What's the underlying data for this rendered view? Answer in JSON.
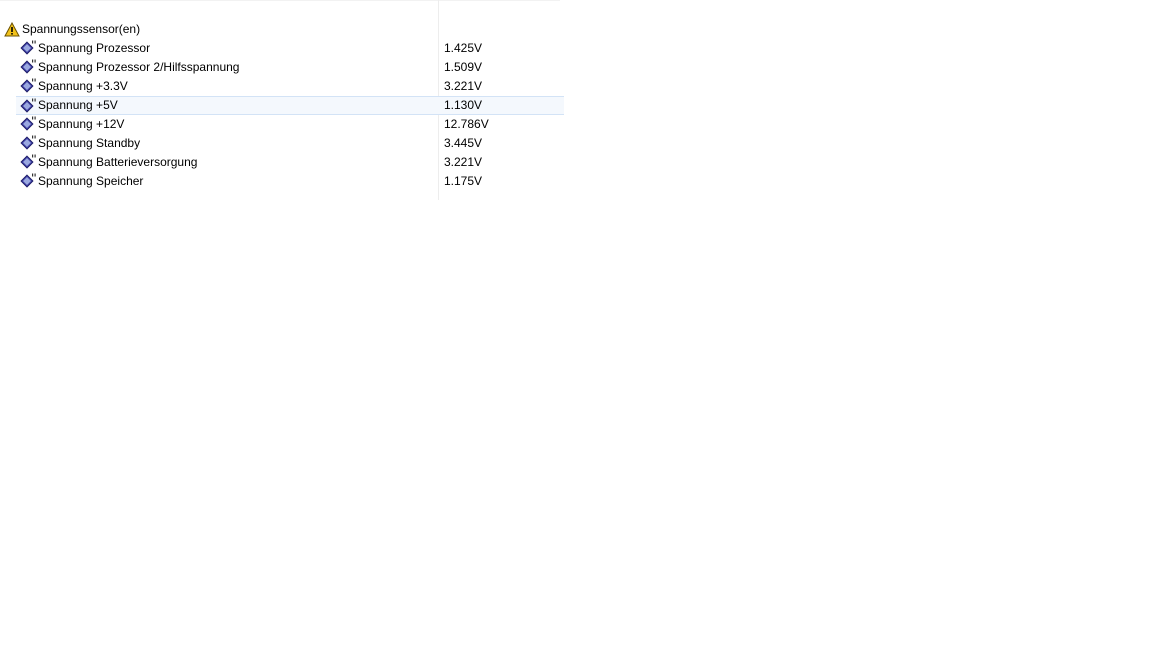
{
  "group": {
    "label": "Spannungssensor(en)",
    "icon": "warning-icon"
  },
  "sensors": [
    {
      "label": "Spannung Prozessor",
      "value": "1.425V"
    },
    {
      "label": "Spannung Prozessor 2/Hilfsspannung",
      "value": "1.509V"
    },
    {
      "label": "Spannung +3.3V",
      "value": "3.221V"
    },
    {
      "label": "Spannung +5V",
      "value": "1.130V"
    },
    {
      "label": "Spannung +12V",
      "value": "12.786V"
    },
    {
      "label": "Spannung Standby",
      "value": "3.445V"
    },
    {
      "label": "Spannung Batterieversorgung",
      "value": "3.221V"
    },
    {
      "label": "Spannung Speicher",
      "value": "1.175V"
    }
  ],
  "selected_index": 3,
  "colors": {
    "selection_bg": "#f4f8fd",
    "selection_border": "#d3e3f6",
    "sensor_icon": "#3a3aa0",
    "warning_icon": "#f2c21a"
  }
}
